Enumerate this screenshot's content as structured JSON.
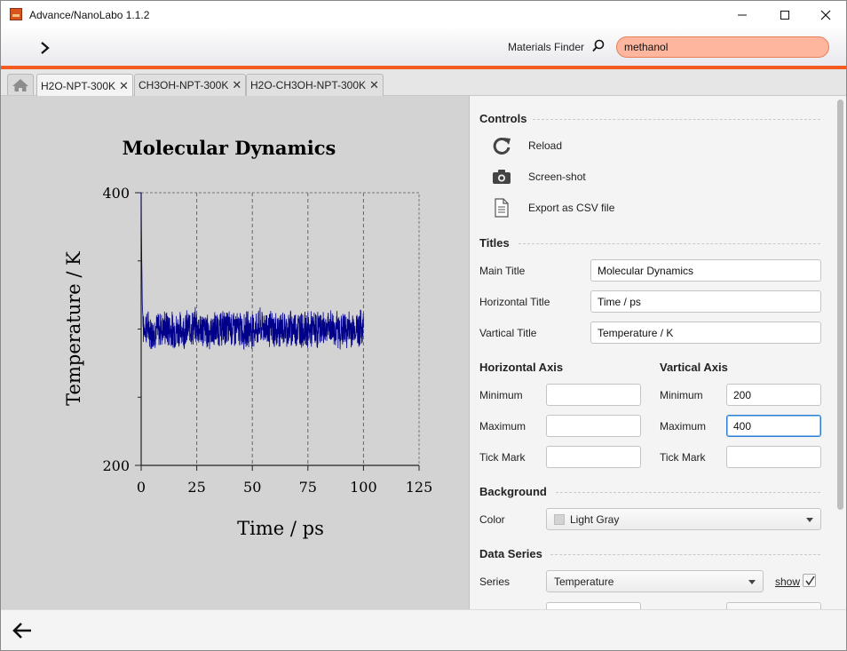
{
  "window": {
    "title": "Advance/NanoLabo 1.1.2"
  },
  "toolbar": {
    "finder_label": "Materials Finder",
    "search_value": "methanol",
    "accent_color": "#f55a22"
  },
  "tabs": [
    {
      "label": "H2O-NPT-300K",
      "active": true
    },
    {
      "label": "CH3OH-NPT-300K",
      "active": false
    },
    {
      "label": "H2O-CH3OH-NPT-300K",
      "active": false
    }
  ],
  "tab_close_glyph": "✕",
  "controls": {
    "heading": "Controls",
    "reload": "Reload",
    "screenshot": "Screen-shot",
    "export_csv": "Export as CSV file"
  },
  "titles": {
    "heading": "Titles",
    "main_title_label": "Main Title",
    "main_title_value": "Molecular Dynamics",
    "horizontal_title_label": "Horizontal Title",
    "horizontal_title_value": "Time / ps",
    "vertical_title_label": "Vartical Title",
    "vertical_title_value": "Temperature / K"
  },
  "horizontal_axis": {
    "heading": "Horizontal Axis",
    "minimum_label": "Minimum",
    "minimum_value": "",
    "maximum_label": "Maximum",
    "maximum_value": "",
    "tickmark_label": "Tick Mark",
    "tickmark_value": ""
  },
  "vertical_axis": {
    "heading": "Vartical Axis",
    "minimum_label": "Minimum",
    "minimum_value": "200",
    "maximum_label": "Maximum",
    "maximum_value": "400",
    "tickmark_label": "Tick Mark",
    "tickmark_value": ""
  },
  "background": {
    "heading": "Background",
    "color_label": "Color",
    "color_value": "Light Gray",
    "swatch": "#d3d3d3"
  },
  "data_series": {
    "heading": "Data Series",
    "series_label": "Series",
    "series_value": "Temperature",
    "show_label": "show",
    "show_checked": true
  },
  "chart_data": {
    "type": "line",
    "title": "Molecular Dynamics",
    "xlabel": "Time / ps",
    "ylabel": "Temperature / K",
    "xlim": [
      0,
      125
    ],
    "ylim": [
      200,
      400
    ],
    "x_ticks": [
      "0",
      "25",
      "50",
      "75",
      "100",
      "125"
    ],
    "y_ticks": [
      "200",
      "400"
    ],
    "grid": "vertical dashed",
    "background": "#d3d3d3",
    "series": [
      {
        "color": "#00008b",
        "x": [
          0,
          0.2,
          0.5,
          1,
          2,
          5,
          10,
          15,
          20,
          25,
          30,
          35,
          40,
          45,
          50,
          55,
          60,
          65,
          70,
          75,
          80,
          85,
          90,
          95,
          100
        ],
        "y": [
          400,
          360,
          320,
          300,
          302,
          298,
          301,
          299,
          300,
          302,
          298,
          300,
          301,
          299,
          300,
          302,
          299,
          300,
          301,
          299,
          300,
          301,
          299,
          300,
          301
        ]
      }
    ]
  }
}
